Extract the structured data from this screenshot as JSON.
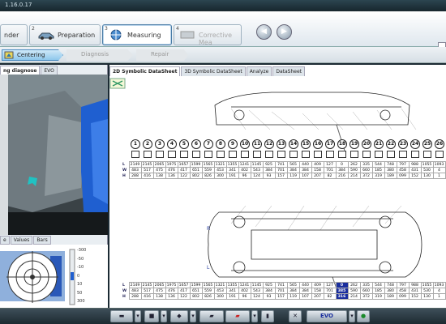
{
  "window": {
    "title": "1.16.0.17"
  },
  "steps": [
    {
      "num": "",
      "label": "nder"
    },
    {
      "num": "2",
      "label": "Preparation"
    },
    {
      "num": "3",
      "label": "Measuring"
    },
    {
      "num": "4",
      "label": "Corrective Mea"
    }
  ],
  "nav": {
    "back_label": "◀",
    "forward_label": "▶"
  },
  "substeps": [
    {
      "label": "Centering"
    },
    {
      "label": "Diagnosis"
    },
    {
      "label": "Repair"
    }
  ],
  "left_tabs": {
    "tab1": "ng diagnose",
    "tab2": "EVO"
  },
  "bottom_tabs": {
    "tab1": "e",
    "tab2": "Values",
    "tab3": "Bars"
  },
  "gauge_scale": [
    "-300",
    "-50",
    "-10",
    "0",
    "10",
    "50",
    "300"
  ],
  "main_tabs": [
    "2D Symbolic DataSheet",
    "3D Symbolic DataSheet",
    "Analyze",
    "DataSheet"
  ],
  "points": [
    "1",
    "2",
    "3",
    "4",
    "5",
    "6",
    "7",
    "8",
    "9",
    "10",
    "11",
    "12",
    "13",
    "14",
    "15",
    "16",
    "17",
    "18",
    "19",
    "20",
    "21",
    "22",
    "23",
    "24",
    "25",
    "26"
  ],
  "car_labels": {
    "R": "R",
    "L": "L"
  },
  "table_top": {
    "row_labels": [
      "L",
      "W",
      "H"
    ],
    "L": [
      "2149",
      "2145",
      "2065",
      "1975",
      "1657",
      "1599",
      "1565",
      "1321",
      "1355",
      "1241",
      "1145",
      "925",
      "741",
      "565",
      "440",
      "409",
      "127",
      "0",
      "262",
      "335",
      "544",
      "748",
      "797",
      "988",
      "1055",
      "1093"
    ],
    "W": [
      "483",
      "517",
      "475",
      "476",
      "417",
      "651",
      "559",
      "453",
      "341",
      "402",
      "543",
      "384",
      "701",
      "384",
      "384",
      "158",
      "701",
      "384",
      "590",
      "660",
      "185",
      "380",
      "458",
      "431",
      "530",
      "4"
    ],
    "H": [
      "288",
      "416",
      "138",
      "136",
      "122",
      "802",
      "826",
      "300",
      "191",
      "96",
      "124",
      "93",
      "157",
      "119",
      "107",
      "207",
      "82",
      "216",
      "214",
      "372",
      "319",
      "189",
      "099",
      "152",
      "130",
      "1"
    ]
  },
  "table_bottom": {
    "row_labels": [
      "L",
      "W",
      "H"
    ],
    "L": [
      "2149",
      "2145",
      "2065",
      "1975",
      "1657",
      "1599",
      "1565",
      "1321",
      "1355",
      "1241",
      "1145",
      "925",
      "741",
      "565",
      "440",
      "409",
      "127",
      "0",
      "262",
      "335",
      "544",
      "748",
      "797",
      "988",
      "1055",
      "1093"
    ],
    "W": [
      "483",
      "517",
      "475",
      "476",
      "417",
      "651",
      "559",
      "453",
      "341",
      "402",
      "543",
      "384",
      "701",
      "384",
      "384",
      "158",
      "701",
      "385",
      "590",
      "660",
      "185",
      "380",
      "458",
      "431",
      "530",
      "4"
    ],
    "H": [
      "288",
      "416",
      "138",
      "136",
      "122",
      "802",
      "826",
      "300",
      "191",
      "96",
      "124",
      "93",
      "157",
      "119",
      "107",
      "207",
      "82",
      "316",
      "214",
      "372",
      "319",
      "189",
      "099",
      "152",
      "130",
      "1"
    ]
  },
  "highlight_index": 17,
  "colors": {
    "accent": "#1a2e9e",
    "blue": "#1f5fd0"
  }
}
